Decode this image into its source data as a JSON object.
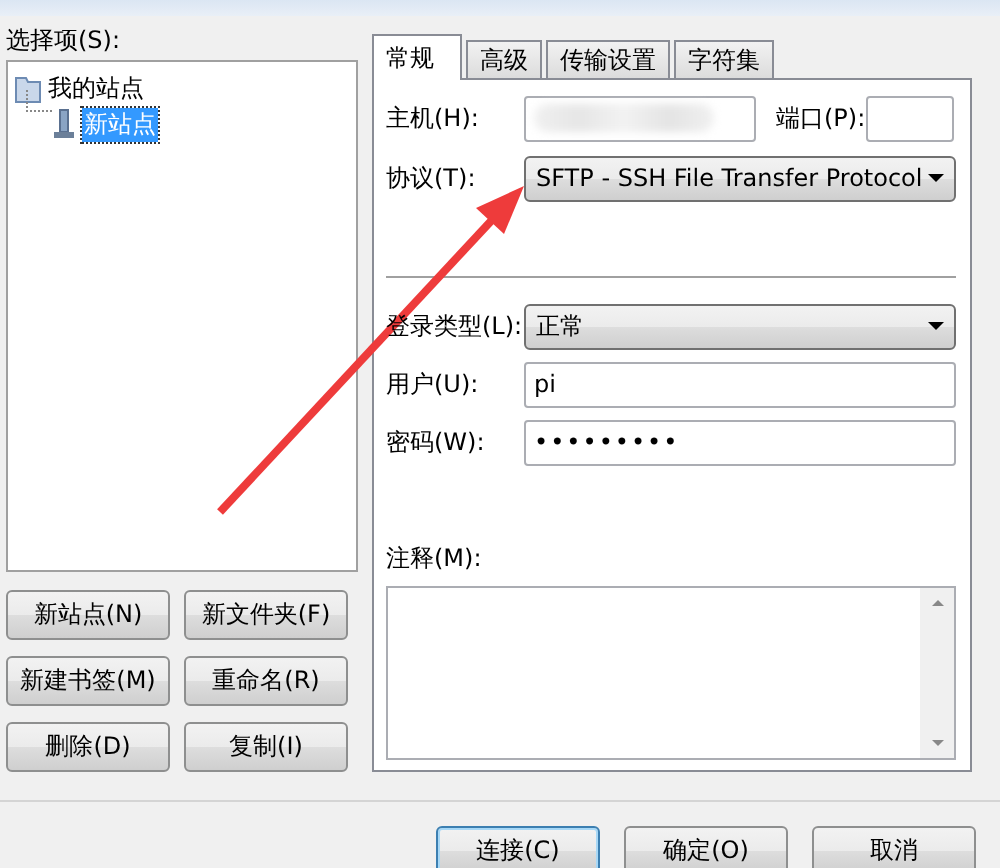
{
  "sidebar": {
    "label": "选择项(S):",
    "tree": [
      {
        "label": "我的站点",
        "expanded": true,
        "selected": false,
        "children": [
          {
            "label": "新站点",
            "selected": true
          }
        ]
      }
    ],
    "buttons": [
      "新站点(N)",
      "新文件夹(F)",
      "新建书签(M)",
      "重命名(R)",
      "删除(D)",
      "复制(I)"
    ]
  },
  "tabs": [
    {
      "label": "常规",
      "selected": true
    },
    {
      "label": "高级",
      "selected": false
    },
    {
      "label": "传输设置",
      "selected": false
    },
    {
      "label": "字符集",
      "selected": false
    }
  ],
  "general": {
    "host": {
      "label": "主机(H):"
    },
    "port": {
      "label": "端口(P):"
    },
    "protocol": {
      "label": "协议(T):",
      "value": "SFTP - SSH File Transfer Protocol"
    },
    "logon_type": {
      "label": "登录类型(L):",
      "value": "正常"
    },
    "user": {
      "label": "用户(U):",
      "value": "pi"
    },
    "password": {
      "label": "密码(W):",
      "value": "•••••••••"
    },
    "comments": {
      "label": "注释(M):"
    }
  },
  "buttons": [
    {
      "label": "连接(C)",
      "focused": true
    },
    {
      "label": "确定(O)",
      "focused": false
    },
    {
      "label": "取消",
      "focused": false
    }
  ]
}
